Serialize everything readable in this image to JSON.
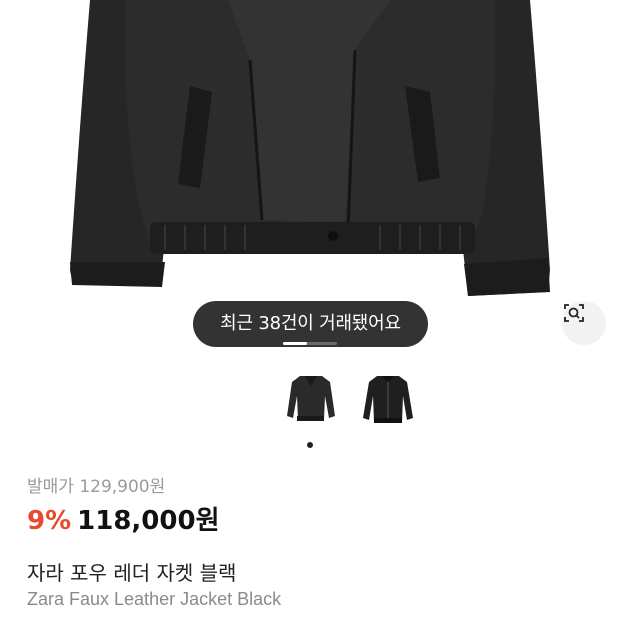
{
  "product": {
    "image_alt": "black leather jacket",
    "recent_trades_toast": "최근 38건이 거래됐어요",
    "gallery_progress": 0.45,
    "thumbnails": [
      {
        "name": "jacket-front-thumbnail",
        "selected": true
      },
      {
        "name": "jacket-bomber-thumbnail",
        "selected": false
      }
    ],
    "original_price": "발매가 129,900원",
    "discount": "9%",
    "price": "118,000원",
    "title_ko": "자라 포우 레더 자켓 블랙",
    "title_en": "Zara Faux Leather Jacket Black"
  },
  "icons": {
    "lens": "image-search-icon"
  },
  "colors": {
    "discount": "#e84a2f",
    "toast_bg": "#222222",
    "muted_text": "#9a9a9a"
  }
}
